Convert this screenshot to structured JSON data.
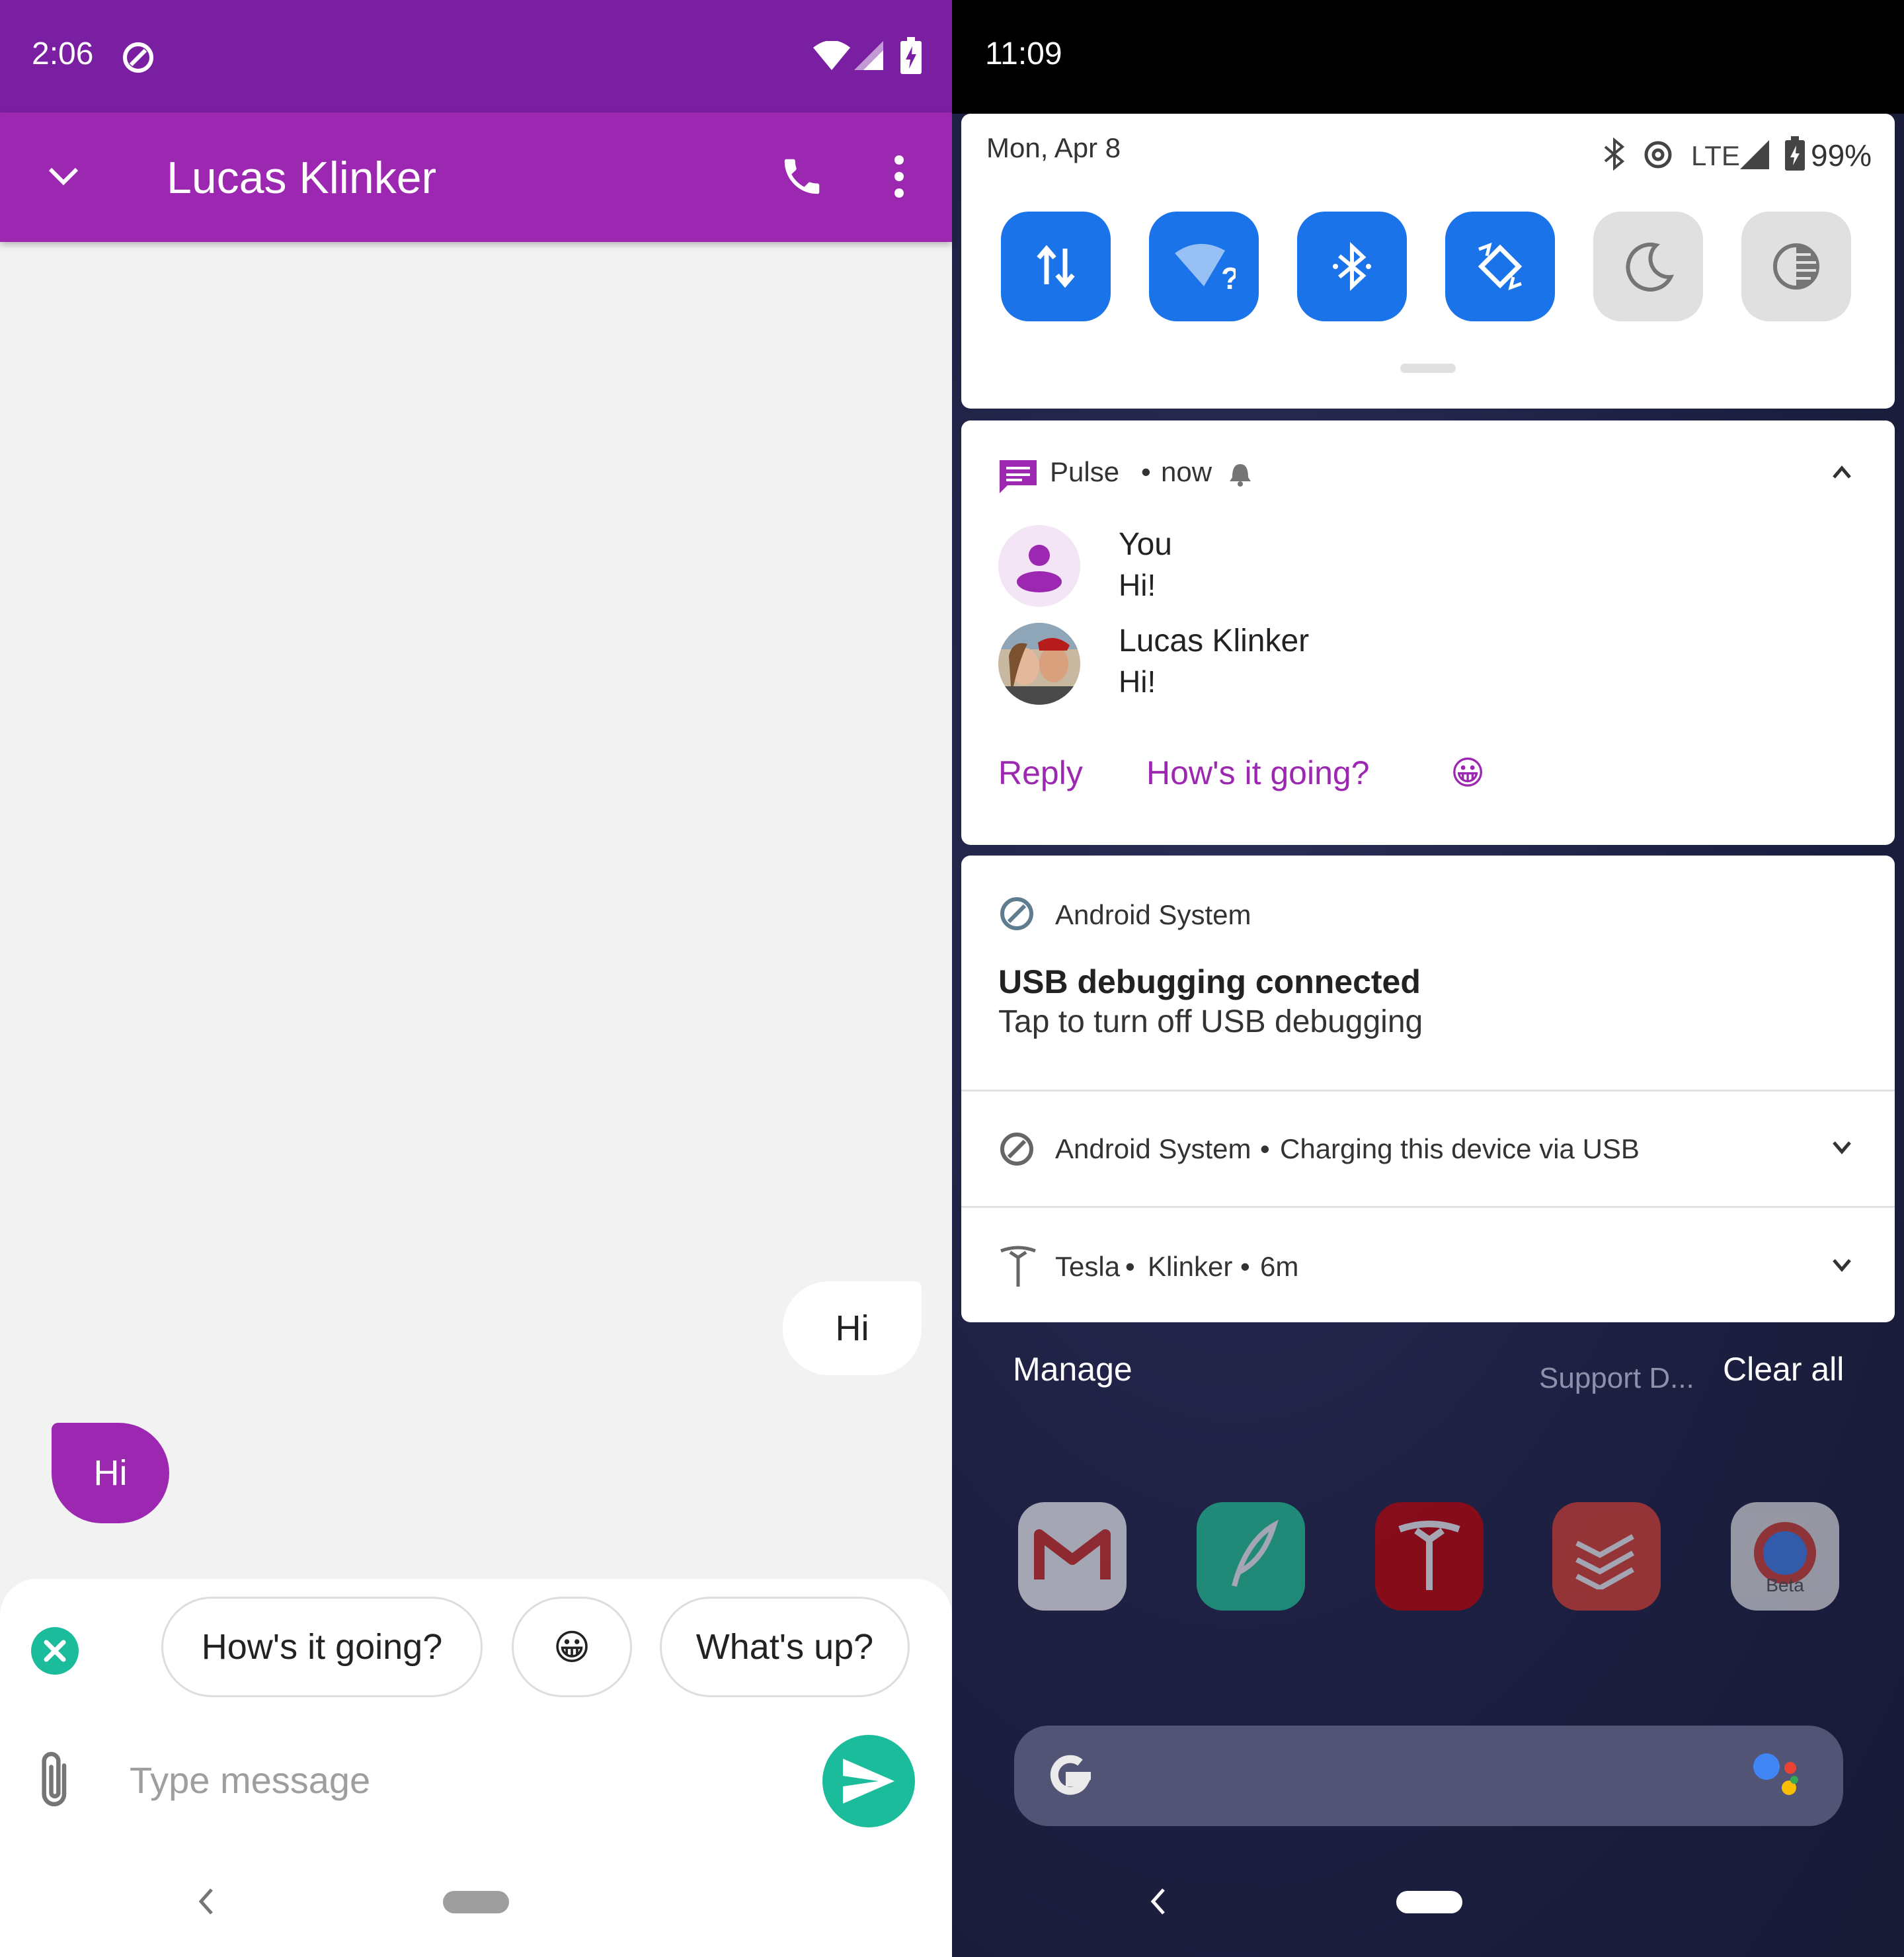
{
  "left": {
    "status_bar": {
      "time": "2:06"
    },
    "app_bar": {
      "title": "Lucas Klinker"
    },
    "messages": [
      {
        "direction": "outgoing",
        "text": "Hi"
      },
      {
        "direction": "incoming",
        "text": "Hi"
      }
    ],
    "smart_replies": [
      "How's it going?",
      "😀",
      "What's up?"
    ],
    "composer": {
      "placeholder": "Type message"
    },
    "colors": {
      "status_bar": "#7b1fa2",
      "app_bar": "#9c27b0",
      "send": "#1abc9c"
    }
  },
  "right": {
    "status_bar": {
      "time": "11:09"
    },
    "quick_settings": {
      "date": "Mon, Apr 8",
      "network": "LTE",
      "battery": "99%",
      "tiles": [
        {
          "icon": "data-transfer-icon",
          "active": true
        },
        {
          "icon": "wifi-question-icon",
          "active": true
        },
        {
          "icon": "bluetooth-icon",
          "active": true
        },
        {
          "icon": "auto-rotate-icon",
          "active": true
        },
        {
          "icon": "moon-icon",
          "active": false
        },
        {
          "icon": "contrast-icon",
          "active": false
        }
      ]
    },
    "notifications": {
      "pulse": {
        "app": "Pulse",
        "separator": "•",
        "time": "now",
        "messages": [
          {
            "sender": "You",
            "text": "Hi!"
          },
          {
            "sender": "Lucas Klinker",
            "text": "Hi!"
          }
        ],
        "actions": [
          "Reply",
          "How's it going?",
          "😀"
        ]
      },
      "android_usb": {
        "app": "Android System",
        "title": "USB debugging connected",
        "text": "Tap to turn off USB debugging"
      },
      "android_charging": {
        "app": "Android System",
        "separator": "•",
        "text": "Charging this device via USB"
      },
      "tesla": {
        "app": "Tesla",
        "separator": "•",
        "text": "Klinker",
        "time": "6m"
      }
    },
    "footer": {
      "manage": "Manage",
      "clear_all": "Clear all"
    },
    "background_labels": {
      "support": "Support D...",
      "chrome_beta": "Beta"
    }
  }
}
